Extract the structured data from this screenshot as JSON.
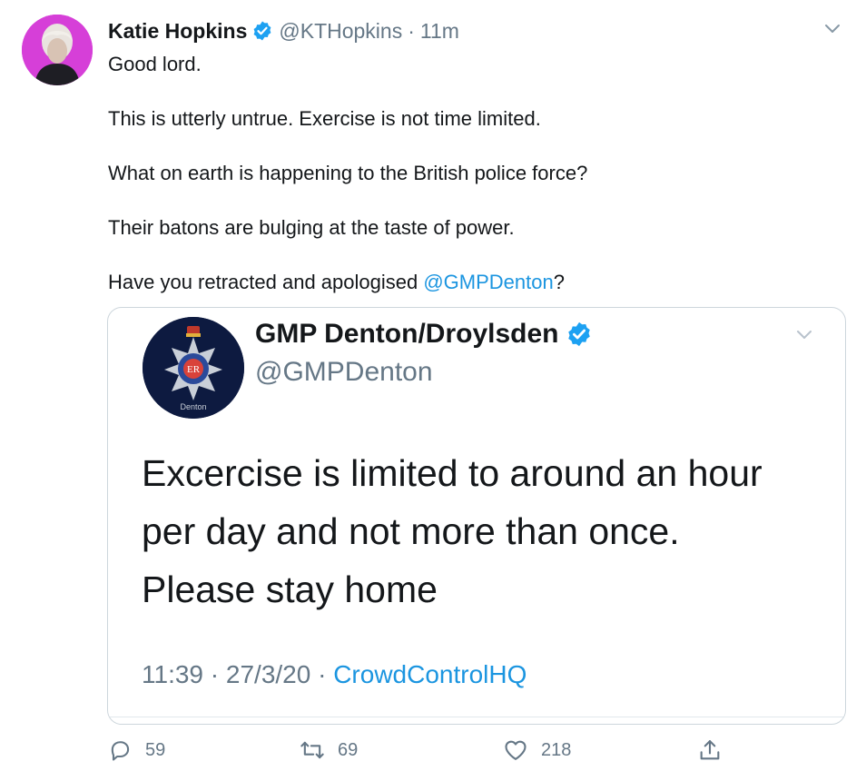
{
  "tweet": {
    "author_name": "Katie Hopkins",
    "author_handle": "@KTHopkins",
    "separator": "·",
    "time": "11m",
    "lines": [
      "Good lord.",
      "This is utterly untrue. Exercise is not time limited.",
      "What on earth is happening to the British police force?",
      "Their batons are bulging at the taste of power."
    ],
    "last_line_prefix": "Have you retracted and apologised ",
    "last_line_mention": "@GMPDenton",
    "last_line_suffix": "?"
  },
  "embedded": {
    "name": "GMP Denton/Droylsden",
    "handle": "@GMPDenton",
    "badge_text": "Denton",
    "crest_text": "ER",
    "text_lines": [
      "Excercise is limited to around an hour",
      "per day and not more than once.",
      "Please stay home"
    ],
    "time": "11:39",
    "date": "27/3/20",
    "sep1": "·",
    "sep2": "·",
    "source": "CrowdControlHQ"
  },
  "actions": {
    "replies": "59",
    "retweets": "69",
    "likes": "218"
  },
  "icons": {
    "verified": "verified-badge-icon",
    "chevron": "chevron-down-icon",
    "reply": "reply-icon",
    "retweet": "retweet-icon",
    "like": "heart-icon",
    "share": "share-icon"
  },
  "colors": {
    "accent": "#1b95e0",
    "secondary_text": "#657786",
    "avatar_bg": "#d63fd8",
    "police_badge_bg": "#0d1a40"
  }
}
